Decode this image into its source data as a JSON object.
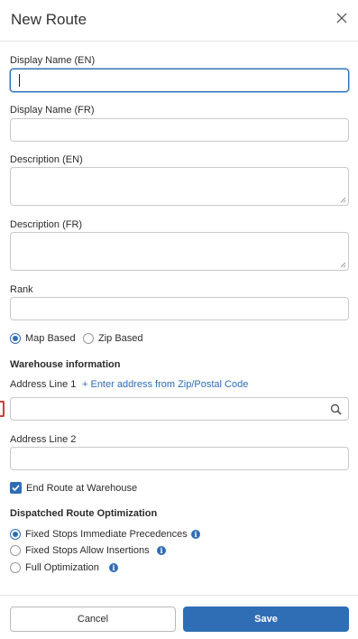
{
  "dialog": {
    "title": "New Route",
    "close_icon": "close-icon"
  },
  "fields": {
    "display_name_en": {
      "label": "Display Name (EN)",
      "value": ""
    },
    "display_name_fr": {
      "label": "Display Name (FR)",
      "value": ""
    },
    "description_en": {
      "label": "Description (EN)",
      "value": ""
    },
    "description_fr": {
      "label": "Description (FR)",
      "value": ""
    },
    "rank": {
      "label": "Rank",
      "value": ""
    }
  },
  "route_type": {
    "options": [
      {
        "label": "Map Based",
        "selected": true
      },
      {
        "label": "Zip Based",
        "selected": false
      }
    ]
  },
  "warehouse": {
    "section_title": "Warehouse information",
    "address_line_1_label": "Address Line 1",
    "zip_link": "+ Enter address from Zip/Postal Code",
    "address_line_1_value": "",
    "address_line_2_label": "Address Line 2",
    "address_line_2_value": "",
    "end_route_label": "End Route at Warehouse",
    "end_route_checked": true,
    "search_icon": "search-icon"
  },
  "optimization": {
    "section_title": "Dispatched Route Optimization",
    "options": [
      {
        "label": "Fixed Stops Immediate Precedences",
        "selected": true
      },
      {
        "label": "Fixed Stops Allow Insertions",
        "selected": false
      },
      {
        "label": "Full Optimization",
        "selected": false
      }
    ],
    "info_icon": "info-icon",
    "info_glyph": "i"
  },
  "footer": {
    "cancel_label": "Cancel",
    "save_label": "Save"
  },
  "colors": {
    "accent": "#2f6db5",
    "marker": "#d23b3b"
  }
}
